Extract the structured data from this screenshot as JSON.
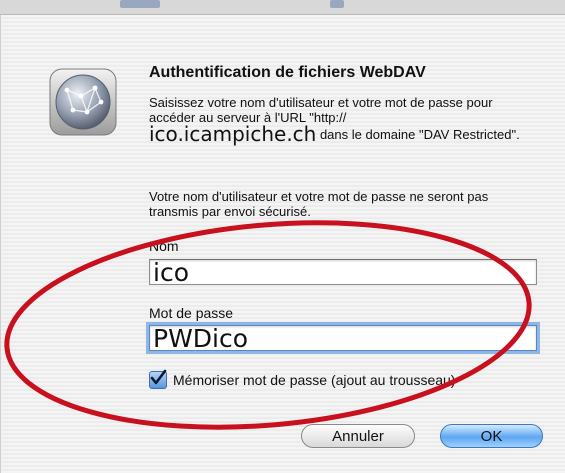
{
  "dialog": {
    "title": "Authentification de fichiers WebDAV",
    "message_part1": "Saisissez votre nom d'utilisateur et votre mot de passe pour accéder au serveur à l'URL \"http://",
    "host": "ico.icampiche.ch",
    "message_part2": " dans le domaine \"DAV Restricted\".",
    "security_note": "Votre nom d'utilisateur et votre mot de passe ne seront pas transmis par envoi sécurisé.",
    "name_label": "Nom",
    "name_value": "ico",
    "password_label": "Mot de passe",
    "password_value": "PWDico",
    "remember_label": "Mémoriser mot de passe (ajout au trousseau)",
    "remember_checked": true,
    "cancel_label": "Annuler",
    "ok_label": "OK"
  },
  "icons": {
    "app_icon": "network-globe-icon",
    "checkbox_mark": "checkmark-icon"
  },
  "colors": {
    "annotation_ellipse": "#c8101e",
    "default_button": "#5ea7f2",
    "focus_ring": "#8fb7e6"
  }
}
